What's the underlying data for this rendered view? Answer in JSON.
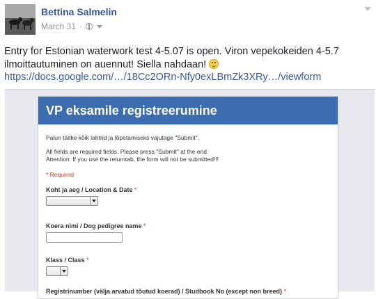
{
  "post": {
    "author": "Bettina Salmelin",
    "date": "March 31",
    "meta_separator": "·",
    "privacy_icon": "globe-icon",
    "text": "Entry for Estonian waterwork test 4-5.07 is open. Viron vepekokeiden 4-5.7 ilmoittautuminen on auennut! Siella nahdaan!",
    "emoji": "smiley-icon",
    "link": "https://docs.google.com/…/18Cc2ORn-Nfy0exLBmZk3XRy…/viewform"
  },
  "form": {
    "title": "VP eksamile registreerumine",
    "intro": "Palun täitke kõik lahtrid ja lõpetamiseks vajutage \"Submit\".",
    "note_line1": "All fields are required fields. Please press \"Submit\" at the end.",
    "note_line2": "Attention: If you use the returntab, the form will not be submitted!!!",
    "required_note": "* Required",
    "questions": [
      {
        "label": "Koht ja aeg / Location & Date",
        "required": "*"
      },
      {
        "label": "Koera nimi / Dog pedigree name",
        "required": "*"
      },
      {
        "label": "Klass / Class",
        "required": "*"
      },
      {
        "label": "Registrinumber (välja arvatud tõutud koerad) / Studbook No (except non breed)",
        "required": "*"
      }
    ]
  },
  "colors": {
    "author_link": "#365899",
    "form_header": "#3b6db0",
    "required_red": "#c43b1d"
  }
}
